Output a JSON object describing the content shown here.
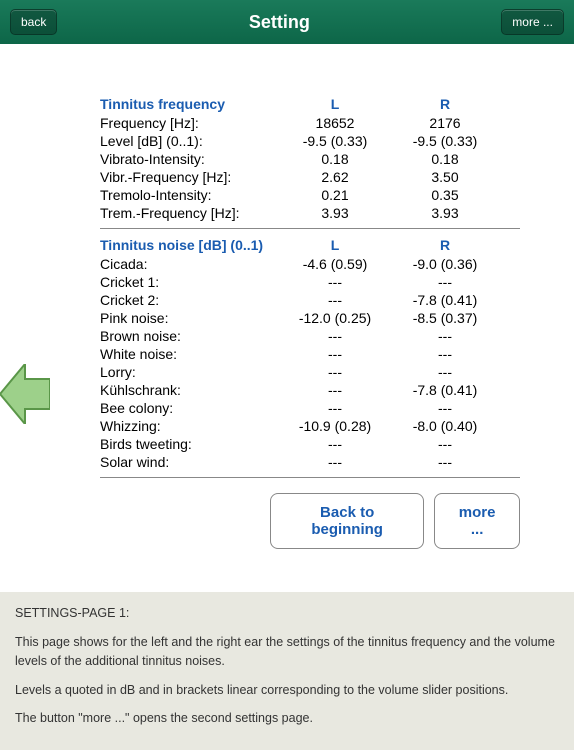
{
  "navbar": {
    "back": "back",
    "title": "Setting",
    "more": "more ..."
  },
  "freq": {
    "header": "Tinnitus frequency",
    "L": "L",
    "R": "R",
    "rows": [
      {
        "label": "Frequency [Hz]:",
        "l": "18652",
        "r": "2176"
      },
      {
        "label": "Level [dB] (0..1):",
        "l": "-9.5 (0.33)",
        "r": "-9.5 (0.33)"
      },
      {
        "label": "Vibrato-Intensity:",
        "l": "0.18",
        "r": "0.18"
      },
      {
        "label": "Vibr.-Frequency [Hz]:",
        "l": "2.62",
        "r": "3.50"
      },
      {
        "label": "Tremolo-Intensity:",
        "l": "0.21",
        "r": "0.35"
      },
      {
        "label": "Trem.-Frequency [Hz]:",
        "l": "3.93",
        "r": "3.93"
      }
    ]
  },
  "noise": {
    "header": "Tinnitus noise [dB] (0..1)",
    "L": "L",
    "R": "R",
    "rows": [
      {
        "label": "Cicada:",
        "l": "-4.6 (0.59)",
        "r": "-9.0 (0.36)"
      },
      {
        "label": "Cricket 1:",
        "l": "---",
        "r": "---"
      },
      {
        "label": "Cricket 2:",
        "l": "---",
        "r": "-7.8 (0.41)"
      },
      {
        "label": "Pink noise:",
        "l": "-12.0 (0.25)",
        "r": "-8.5 (0.37)"
      },
      {
        "label": "Brown noise:",
        "l": "---",
        "r": "---"
      },
      {
        "label": "White noise:",
        "l": "---",
        "r": "---"
      },
      {
        "label": "Lorry:",
        "l": "---",
        "r": "---"
      },
      {
        "label": "Kühlschrank:",
        "l": "---",
        "r": "-7.8 (0.41)"
      },
      {
        "label": "Bee colony:",
        "l": "---",
        "r": "---"
      },
      {
        "label": "Whizzing:",
        "l": "-10.9 (0.28)",
        "r": "-8.0 (0.40)"
      },
      {
        "label": "Birds tweeting:",
        "l": "---",
        "r": "---"
      },
      {
        "label": "Solar wind:",
        "l": "---",
        "r": "---"
      }
    ]
  },
  "buttons": {
    "back_to_beginning": "Back to beginning",
    "more": "more ..."
  },
  "footer": {
    "title": "SETTINGS-PAGE 1:",
    "p1": "This page shows for the left and the right ear the settings of the tinnitus frequency and the volume levels of the additional tinnitus noises.",
    "p2": "Levels a quoted in dB and in brackets linear corresponding to the volume slider positions.",
    "p3": "The button \"more ...\" opens the second settings page."
  }
}
